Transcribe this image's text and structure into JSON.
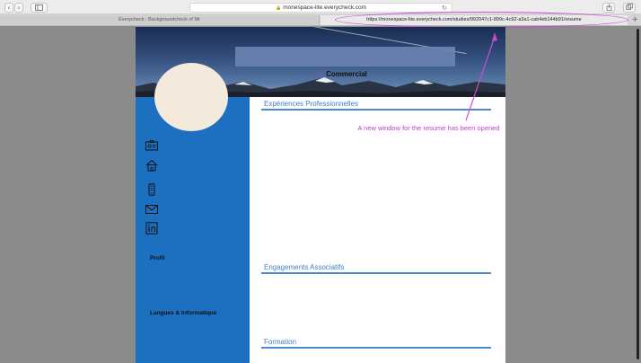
{
  "browser": {
    "address_text": "monespace-lite.everycheck.com",
    "tabs": [
      {
        "label": "Everycheck : Backgroundcheck of Mr"
      },
      {
        "label": "https://monespace-lite.everycheck.com/studies/992047c1-899c-4c92-a3a1-cab4eb144b91/resume"
      }
    ]
  },
  "annotation": {
    "text": "A new window for the resume has been opened",
    "color": "#c040d0"
  },
  "resume": {
    "job_title": "Commercial",
    "sidebar_icons": [
      "id-card-icon",
      "home-icon",
      "phone-icon",
      "mail-icon",
      "linkedin-icon"
    ],
    "sidebar_sections": [
      "Profil",
      "Langues & Informatique"
    ],
    "sections": [
      "Expériences Professionnelles",
      "Engagements Associatifs",
      "Formation"
    ],
    "accent_color": "#1d6fbf"
  }
}
